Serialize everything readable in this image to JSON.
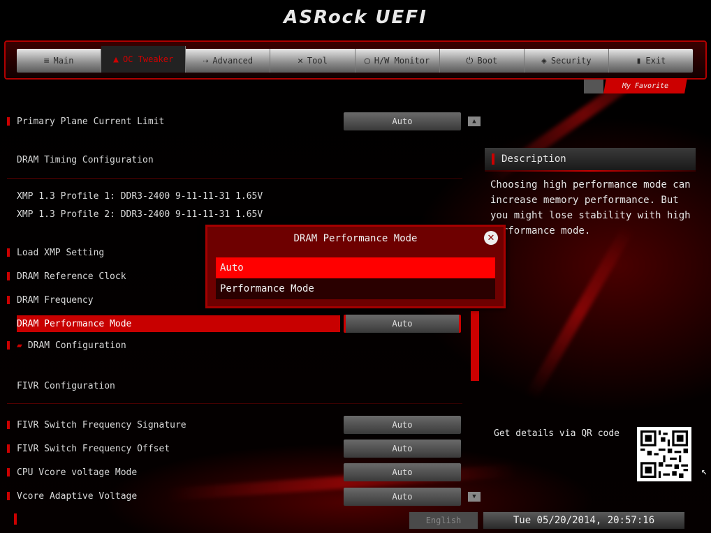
{
  "header": {
    "brand": "ASRock UEFI"
  },
  "nav": {
    "tabs": [
      {
        "label": "Main",
        "icon": "list-icon"
      },
      {
        "label": "OC Tweaker",
        "icon": "flame-icon",
        "active": true
      },
      {
        "label": "Advanced",
        "icon": "advanced-icon"
      },
      {
        "label": "Tool",
        "icon": "tool-icon"
      },
      {
        "label": "H/W Monitor",
        "icon": "monitor-icon"
      },
      {
        "label": "Boot",
        "icon": "power-icon"
      },
      {
        "label": "Security",
        "icon": "shield-icon"
      },
      {
        "label": "Exit",
        "icon": "exit-icon"
      }
    ],
    "favorite_label": "My Favorite"
  },
  "settings": {
    "primary_plane_label": "Primary Plane Current Limit",
    "primary_plane_value": "Auto",
    "dram_timing_header": "DRAM Timing Configuration",
    "xmp_profile_1": "XMP 1.3 Profile 1: DDR3-2400 9-11-11-31 1.65V",
    "xmp_profile_2": "XMP 1.3 Profile 2: DDR3-2400 9-11-11-31 1.65V",
    "load_xmp": "Load XMP Setting",
    "dram_ref_clock": "DRAM Reference Clock",
    "dram_frequency": "DRAM Frequency",
    "dram_perf_mode": "DRAM Performance Mode",
    "dram_perf_mode_value": "Auto",
    "dram_configuration": "DRAM Configuration",
    "fivr_header": "FIVR Configuration",
    "fivr_switch_sig": "FIVR Switch Frequency Signature",
    "fivr_switch_sig_value": "Auto",
    "fivr_switch_offset": "FIVR Switch Frequency Offset",
    "fivr_switch_offset_value": "Auto",
    "cpu_vcore_mode": "CPU Vcore voltage Mode",
    "cpu_vcore_mode_value": "Auto",
    "vcore_adaptive": "Vcore Adaptive Voltage",
    "vcore_adaptive_value": "Auto"
  },
  "dialog": {
    "title": "DRAM Performance Mode",
    "options": [
      "Auto",
      "Performance Mode"
    ],
    "selected": "Auto"
  },
  "description": {
    "title": "Description",
    "text": "Choosing high performance mode can increase memory performance. But you might lose stability with high performance mode.",
    "qr_label": "Get details via QR code"
  },
  "footer": {
    "language": "English",
    "datetime": "Tue 05/20/2014, 20:57:16"
  },
  "colors": {
    "accent": "#c80000",
    "dialog_bg": "#6e0000",
    "selected_option": "#ff0000"
  }
}
